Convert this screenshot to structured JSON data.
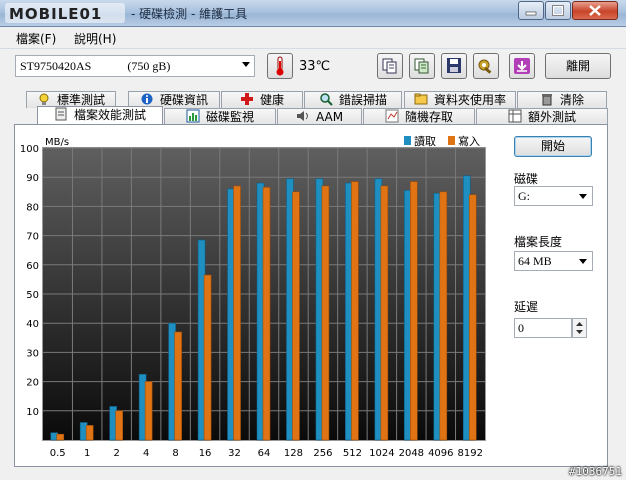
{
  "window": {
    "logo": "MOBILE01",
    "title": "- 硬碟檢測 - 維護工具"
  },
  "menu": [
    {
      "label": "檔案(F)"
    },
    {
      "label": "說明(H)"
    }
  ],
  "toolbar": {
    "drive": "ST9750420AS            (750 gB)",
    "temperature": "33℃",
    "exit_label": "離開"
  },
  "tabs_row1": [
    {
      "label": "標準測試",
      "icon": "bulb-icon"
    },
    {
      "label": "硬碟資訊",
      "icon": "info-icon"
    },
    {
      "label": "健康",
      "icon": "plus-icon"
    },
    {
      "label": "錯誤掃描",
      "icon": "magnifier-icon"
    },
    {
      "label": "資料夾使用率",
      "icon": "folder-icon"
    },
    {
      "label": "清除",
      "icon": "trash-icon"
    }
  ],
  "tabs_row2": [
    {
      "label": "檔案效能測試",
      "icon": "file-icon",
      "active": true
    },
    {
      "label": "磁碟監視",
      "icon": "chart-icon"
    },
    {
      "label": "AAM",
      "icon": "speaker-icon"
    },
    {
      "label": "隨機存取",
      "icon": "random-icon"
    },
    {
      "label": "額外測試",
      "icon": "grid-icon"
    }
  ],
  "side": {
    "start_label": "開始",
    "disk_label": "磁碟",
    "disk_value": "G:",
    "file_length_label": "檔案長度",
    "file_length_value": "64 MB",
    "delay_label": "延遲",
    "delay_value": "0"
  },
  "colors": {
    "read": "#1e8fc0",
    "write": "#e07414"
  },
  "watermark": "#1036751",
  "chart_data": {
    "type": "bar",
    "ylabel": "MB/s",
    "ylim": [
      0,
      100
    ],
    "yticks": [
      10,
      20,
      30,
      40,
      50,
      60,
      70,
      80,
      90,
      100
    ],
    "categories": [
      "0.5",
      "1",
      "2",
      "4",
      "8",
      "16",
      "32",
      "64",
      "128",
      "256",
      "512",
      "1024",
      "2048",
      "4096",
      "8192"
    ],
    "series": [
      {
        "name": "讀取",
        "values": [
          2.5,
          6,
          11.5,
          22.5,
          40,
          68.5,
          86,
          88,
          89.5,
          89.5,
          88,
          89.5,
          85.5,
          84.5,
          90.5
        ]
      },
      {
        "name": "寫入",
        "values": [
          2,
          5,
          10,
          20,
          37,
          56.5,
          87,
          86.5,
          85,
          87,
          88.5,
          87,
          88.5,
          85,
          84
        ]
      }
    ],
    "legend": "top-right",
    "grid": true
  }
}
